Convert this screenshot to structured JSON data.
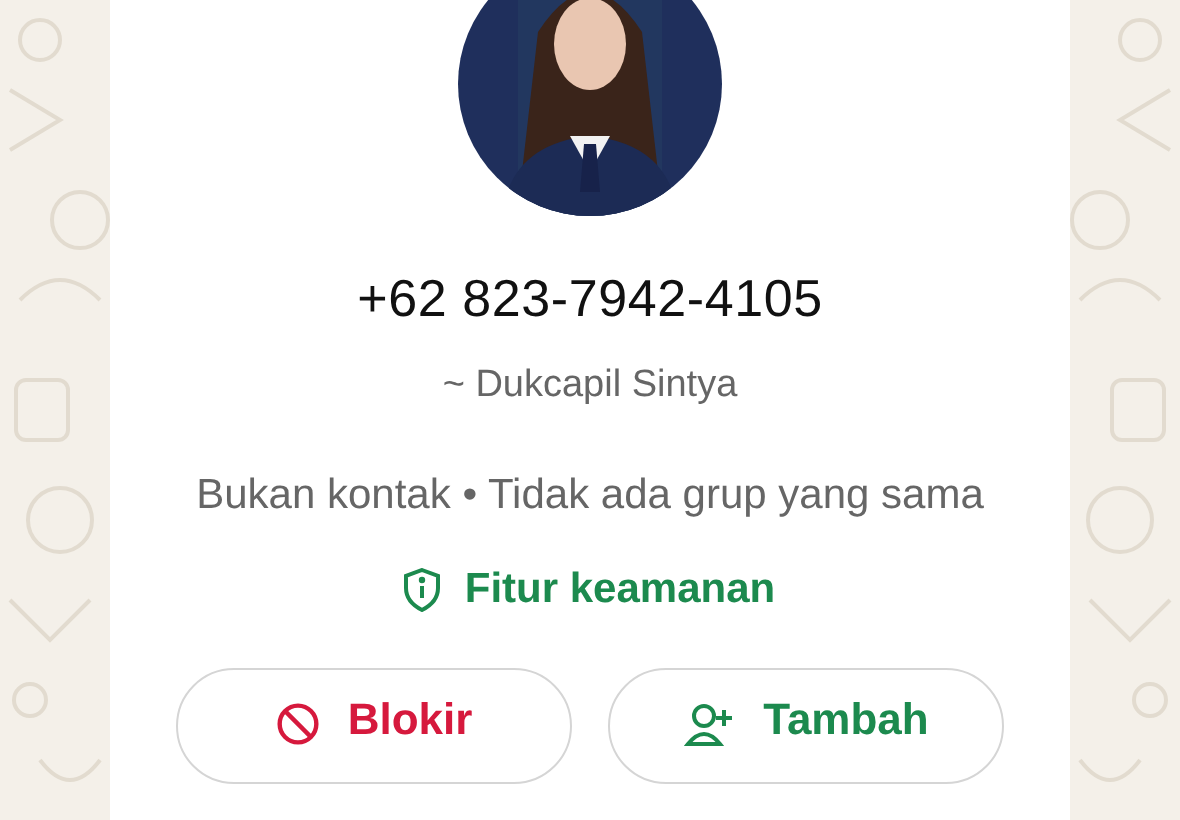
{
  "profile": {
    "phone": "+62 823-7942-4105",
    "push_name": "~ Dukcapil Sintya",
    "info": "Bukan kontak • Tidak ada grup yang sama",
    "security_link": "Fitur keamanan"
  },
  "actions": [
    {
      "kind": "block",
      "label": "Blokir"
    },
    {
      "kind": "add",
      "label": "Tambah"
    }
  ]
}
